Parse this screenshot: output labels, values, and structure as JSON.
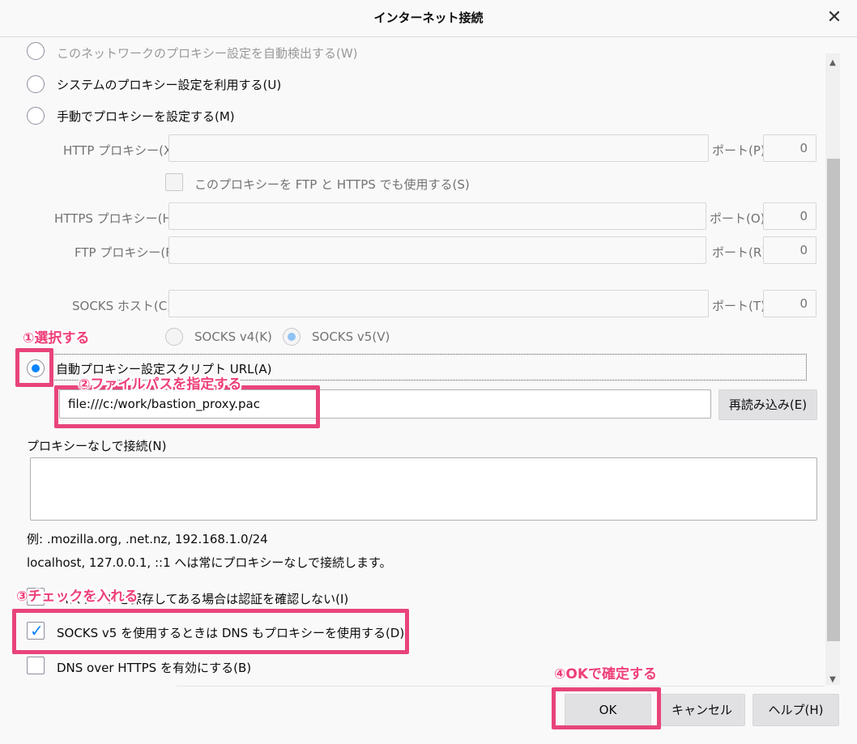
{
  "dialog": {
    "title": "インターネット接続",
    "close_glyph": "✕"
  },
  "proxy": {
    "autodetect_label": "このネットワークのプロキシー設定を自動検出する(W)",
    "system_label": "システムのプロキシー設定を利用する(U)",
    "manual_label": "手動でプロキシーを設定する(M)",
    "http_label": "HTTP プロキシー(X)",
    "http_port_label": "ポート(P)",
    "http_port_value": "0",
    "share_label": "このプロキシーを FTP と HTTPS でも使用する(S)",
    "https_label": "HTTPS プロキシー(H)",
    "https_port_label": "ポート(O)",
    "https_port_value": "0",
    "ftp_label": "FTP プロキシー(F)",
    "ftp_port_label": "ポート(R)",
    "ftp_port_value": "0",
    "socks_label": "SOCKS ホスト(C)",
    "socks_port_label": "ポート(T)",
    "socks_port_value": "0",
    "socks_v4_label": "SOCKS v4(K)",
    "socks_v5_label": "SOCKS v5(V)",
    "auto_url_label": "自動プロキシー設定スクリプト URL(A)",
    "auto_url_value": "file:///c:/work/bastion_proxy.pac",
    "reload_label": "再読み込み(E)",
    "no_proxy_label": "プロキシーなしで接続(N)",
    "example_text": "例: .mozilla.org, .net.nz, 192.168.1.0/24",
    "localhost_text": "localhost, 127.0.0.1, ::1 へは常にプロキシーなしで接続します。",
    "no_prompt_label": "パスワードを保存してある場合は認証を確認しない(I)",
    "socks_dns_label": "SOCKS v5 を使用するときは DNS もプロキシーを使用する(D)",
    "doh_label": "DNS over HTTPS を有効にする(B)"
  },
  "buttons": {
    "ok": "OK",
    "cancel": "キャンセル",
    "help": "ヘルプ(H)"
  },
  "annotations": {
    "step1": "①選択する",
    "step2": "②ファイルパスを指定する",
    "step3": "③チェックを入れる",
    "step4": "④OKで確定する"
  },
  "colors": {
    "accent": "#0a84ff",
    "annotation": "#e8447a"
  }
}
